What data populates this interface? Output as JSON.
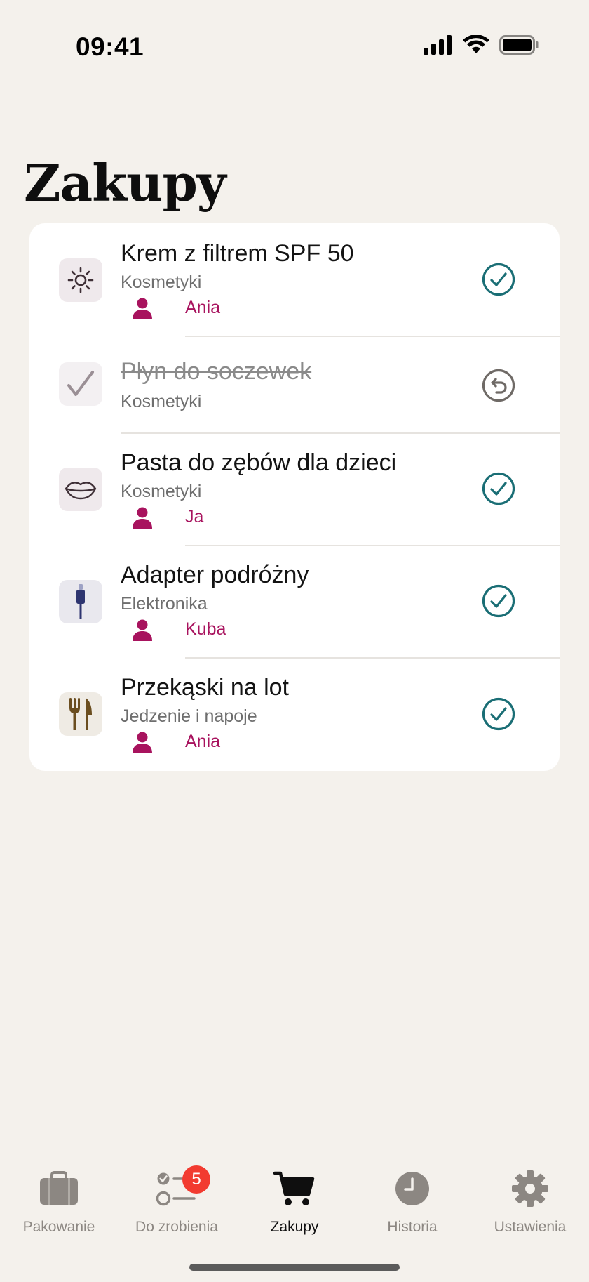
{
  "status_bar": {
    "time": "09:41"
  },
  "page": {
    "title": "Zakupy"
  },
  "items": [
    {
      "title": "Krem z filtrem SPF 50",
      "category": "Kosmetyki",
      "person": "Ania",
      "done": false,
      "icon": "sun-icon",
      "action": "check-icon"
    },
    {
      "title": "Płyn do soczewek",
      "category": "Kosmetyki",
      "person": "",
      "done": true,
      "icon": "checkmark-icon",
      "action": "undo-icon"
    },
    {
      "title": "Pasta do zębów dla dzieci",
      "category": "Kosmetyki",
      "person": "Ja",
      "done": false,
      "icon": "lips-icon",
      "action": "check-icon"
    },
    {
      "title": "Adapter podróżny",
      "category": "Elektronika",
      "person": "Kuba",
      "done": false,
      "icon": "plug-icon",
      "action": "check-icon"
    },
    {
      "title": "Przekąski na lot",
      "category": "Jedzenie i napoje",
      "person": "Ania",
      "done": false,
      "icon": "fork-knife-icon",
      "action": "check-icon"
    }
  ],
  "tabs": [
    {
      "label": "Pakowanie",
      "icon": "suitcase-icon",
      "active": false
    },
    {
      "label": "Do zrobienia",
      "icon": "checklist-icon",
      "active": false,
      "badge": "5"
    },
    {
      "label": "Zakupy",
      "icon": "cart-icon",
      "active": true
    },
    {
      "label": "Historia",
      "icon": "clock-icon",
      "active": false
    },
    {
      "label": "Ustawienia",
      "icon": "gear-icon",
      "active": false
    }
  ],
  "colors": {
    "background": "#f4f1ec",
    "accent_teal": "#1a6e75",
    "person_magenta": "#a8135e",
    "badge_red": "#f23b30"
  }
}
